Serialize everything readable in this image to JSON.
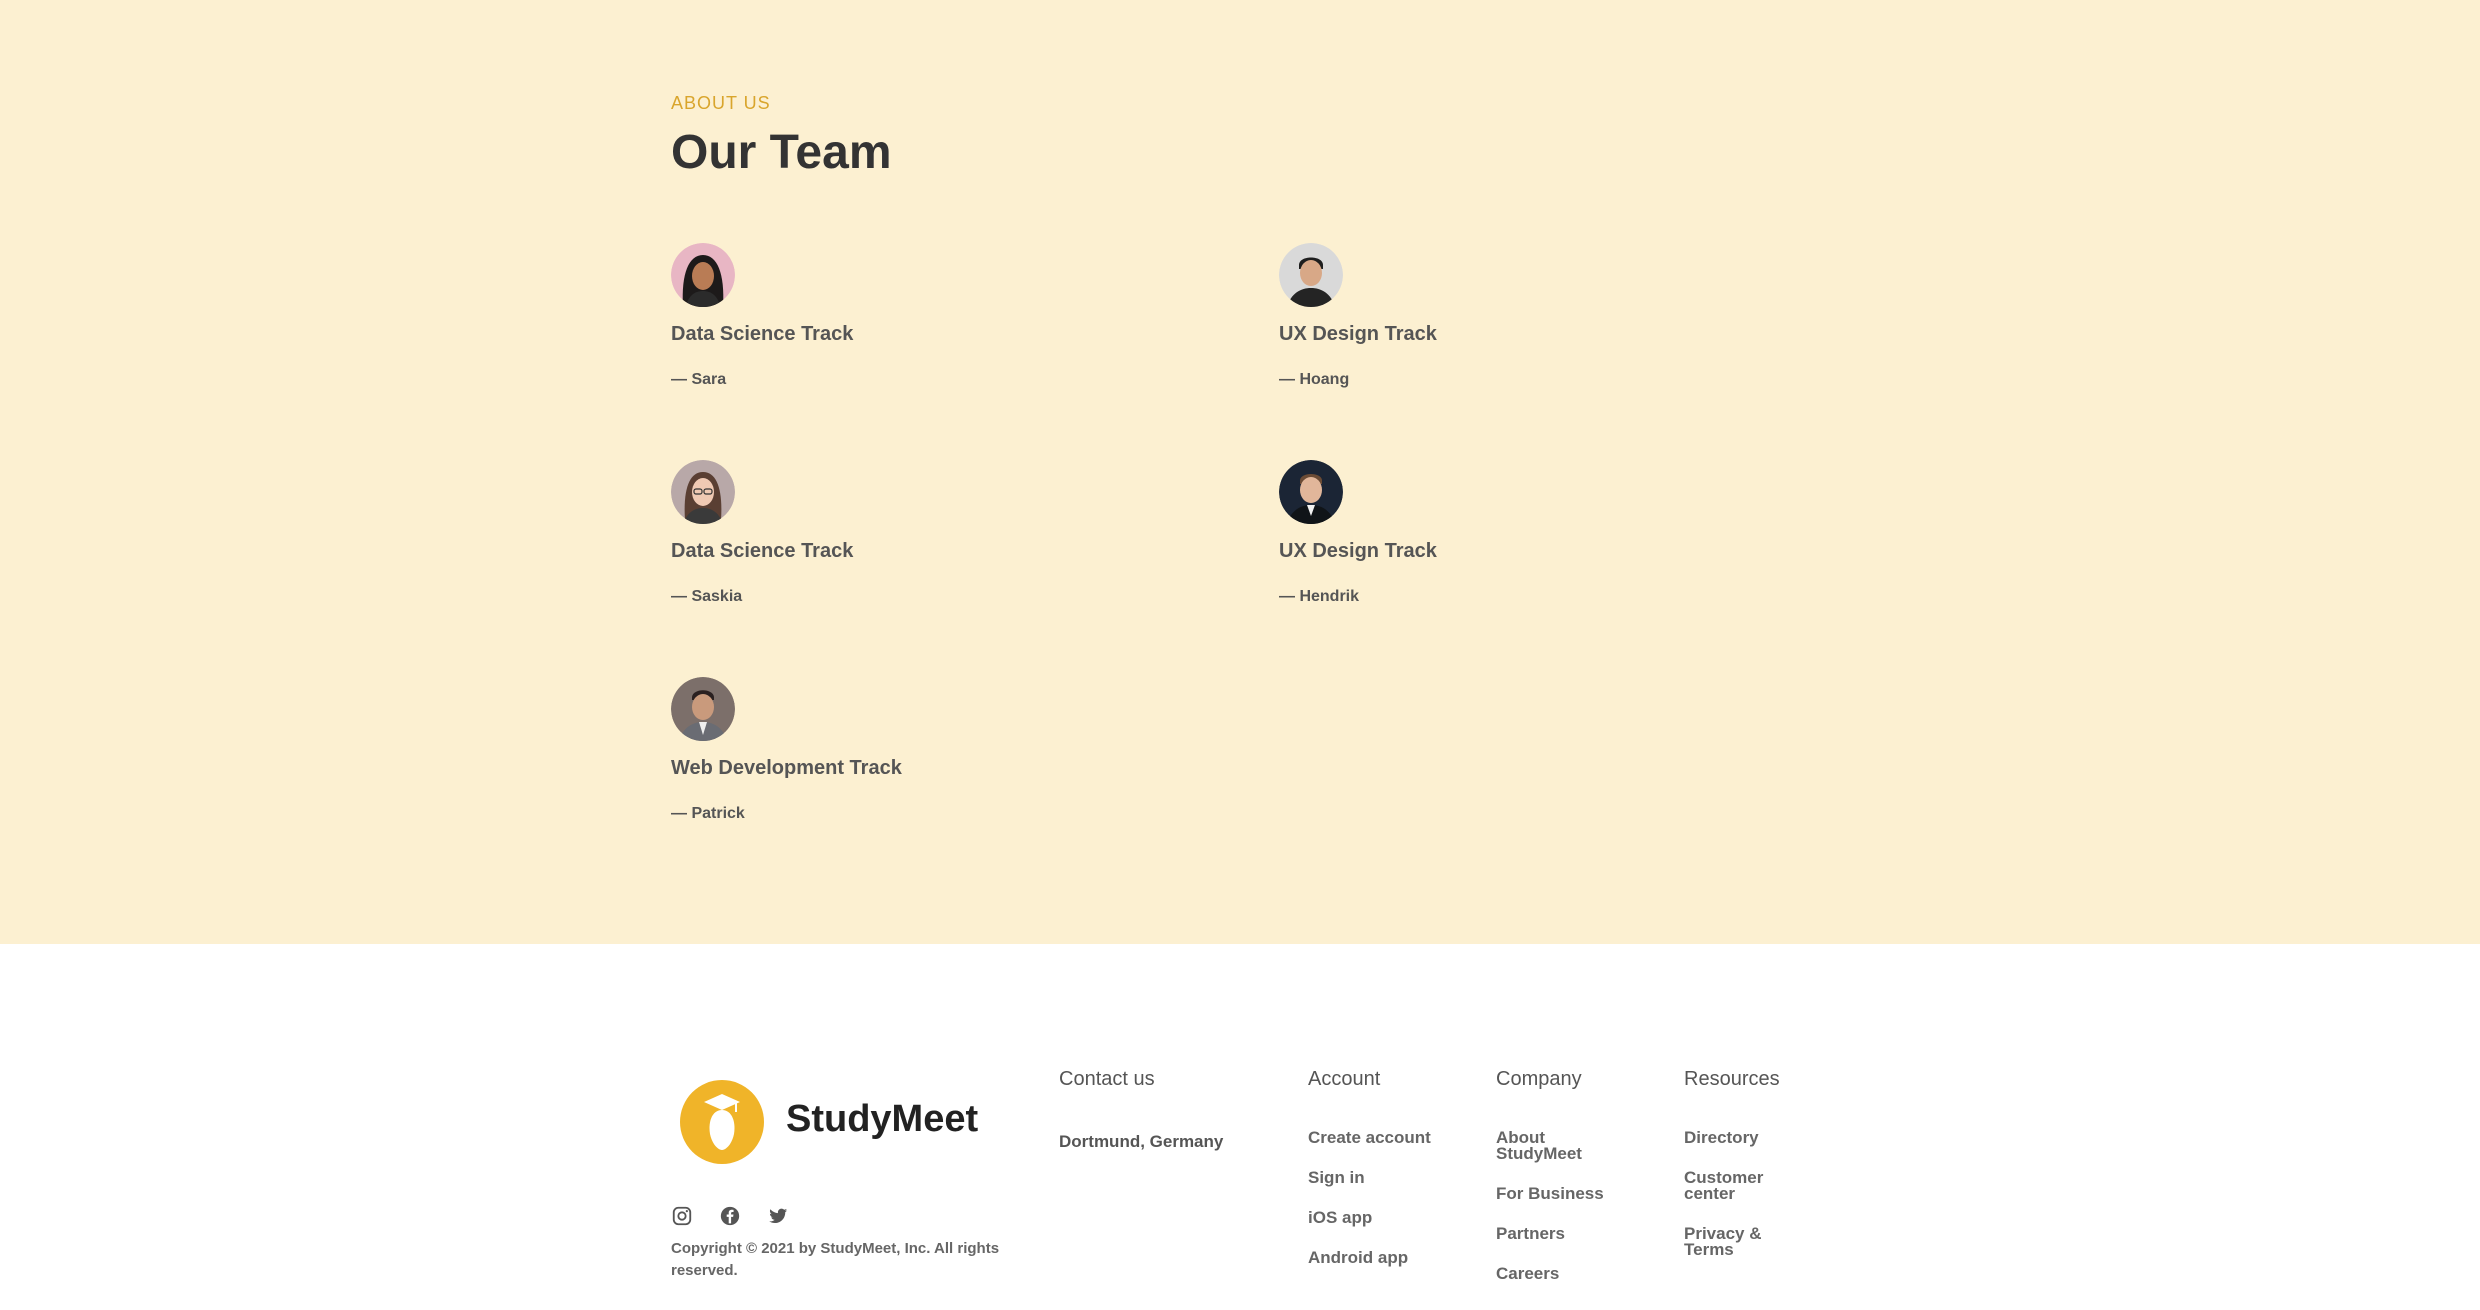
{
  "about": {
    "eyebrow": "ABOUT US",
    "title": "Our Team",
    "members": [
      {
        "track": "Data Science Track",
        "name": "— Sara"
      },
      {
        "track": "UX Design Track",
        "name": "— Hoang"
      },
      {
        "track": "Data Science Track",
        "name": "— Saskia"
      },
      {
        "track": "UX Design Track",
        "name": "— Hendrik"
      },
      {
        "track": "Web Development Track",
        "name": "— Patrick"
      }
    ]
  },
  "footer": {
    "brand": "StudyMeet",
    "brand_color": "#f0b429",
    "social_icons": [
      "instagram-icon",
      "facebook-icon",
      "twitter-icon"
    ],
    "copyright": "Copyright © 2021 by StudyMeet, Inc. All rights reserved.",
    "contact": {
      "title": "Contact us",
      "address": "Dortmund, Germany"
    },
    "account": {
      "title": "Account",
      "links": [
        "Create account",
        "Sign in",
        "iOS app",
        "Android app"
      ]
    },
    "company": {
      "title": "Company",
      "links": [
        "About StudyMeet",
        "For Business",
        "Partners",
        "Careers"
      ]
    },
    "resources": {
      "title": "Resources",
      "links": [
        "Directory",
        "Customer center",
        "Privacy & Terms"
      ]
    }
  },
  "colors": {
    "section_bg": "#fcf0d1",
    "accent": "#d9a52c",
    "text_dark": "#333333"
  }
}
